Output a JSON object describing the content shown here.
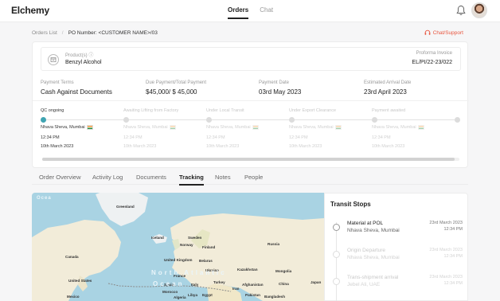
{
  "app": {
    "logo": "Elchemy",
    "logo_accent": "#e8553e"
  },
  "topnav": {
    "tabs": [
      {
        "label": "Orders",
        "active": true
      },
      {
        "label": "Chat",
        "active": false
      }
    ]
  },
  "breadcrumb": {
    "root": "Orders List",
    "separator": "/",
    "current": "PO Number: <CUSTOMER NAME>/03"
  },
  "support": {
    "label": "Chat/Support"
  },
  "product": {
    "label": "Product(s)",
    "value": "Benzyl Alcohol",
    "invoice_label": "Proforma Invoice",
    "invoice_value": "EL/PI/22-23/022"
  },
  "details": [
    {
      "label": "Payment Terms",
      "value": "Cash Against Documents"
    },
    {
      "label": "Due Payment/Total Payment",
      "value": "$45,000/ $ 45,000"
    },
    {
      "label": "Payment Date",
      "value": "03rd May 2023"
    },
    {
      "label": "Estimated Arrival Date",
      "value": "23rd April 2023"
    }
  ],
  "stages": [
    {
      "name": "QC ongoing",
      "location": "Nhava Sheva, Mumbai",
      "time": "12:34 PM",
      "date": "10th March 2023",
      "active": true
    },
    {
      "name": "Awaiting Lifting from Factory",
      "location": "Nhava Sheva, Mumbai",
      "time": "12:34 PM",
      "date": "10th March 2023",
      "active": false
    },
    {
      "name": "Under Local Transit",
      "location": "Nhava Sheva, Mumbai",
      "time": "12:34 PM",
      "date": "10th March 2023",
      "active": false
    },
    {
      "name": "Under Export Clearance",
      "location": "Nhava Sheva, Mumbai",
      "time": "12:34 PM",
      "date": "10th March 2023",
      "active": false
    },
    {
      "name": "Payment awaited",
      "location": "Nhava Sheva, Mumbai",
      "time": "12:34 PM",
      "date": "10th March 2023",
      "active": false
    }
  ],
  "subtabs": [
    {
      "label": "Order Overview",
      "active": false
    },
    {
      "label": "Activity Log",
      "active": false
    },
    {
      "label": "Documents",
      "active": false
    },
    {
      "label": "Tracking",
      "active": true
    },
    {
      "label": "Notes",
      "active": false
    },
    {
      "label": "People",
      "active": false
    }
  ],
  "map": {
    "labels": [
      "Greenland",
      "Iceland",
      "Sweden",
      "Norway",
      "Finland",
      "Russia",
      "Canada",
      "United Kingdom",
      "Belarus",
      "Ukraine",
      "Kazakhstan",
      "Mongolia",
      "United States",
      "France",
      "Spain",
      "Turkey",
      "Italy",
      "China",
      "Iran",
      "Afghanistan",
      "Morocco",
      "Libya",
      "Egypt",
      "Pakistan",
      "Japan",
      "Algeria",
      "Mexico",
      "Bangladesh"
    ],
    "oceans": [
      "North Atlantic",
      "Ocean",
      "Ocea"
    ]
  },
  "transit": {
    "title": "Transit Stops",
    "stops": [
      {
        "name": "Material at POL",
        "place": "Nhava Sheva, Mumbai",
        "date": "23rd March 2023",
        "time": "12:34 PM",
        "active": true
      },
      {
        "name": "Origin Departure",
        "place": "Nhava Sheva, Mumbai",
        "date": "23rd March 2023",
        "time": "12:34 PM",
        "active": false
      },
      {
        "name": "Trans-shipment arrival",
        "place": "Jebel Ali, UAE",
        "date": "23rd March 2023",
        "time": "12:34 PM",
        "active": false
      }
    ]
  }
}
